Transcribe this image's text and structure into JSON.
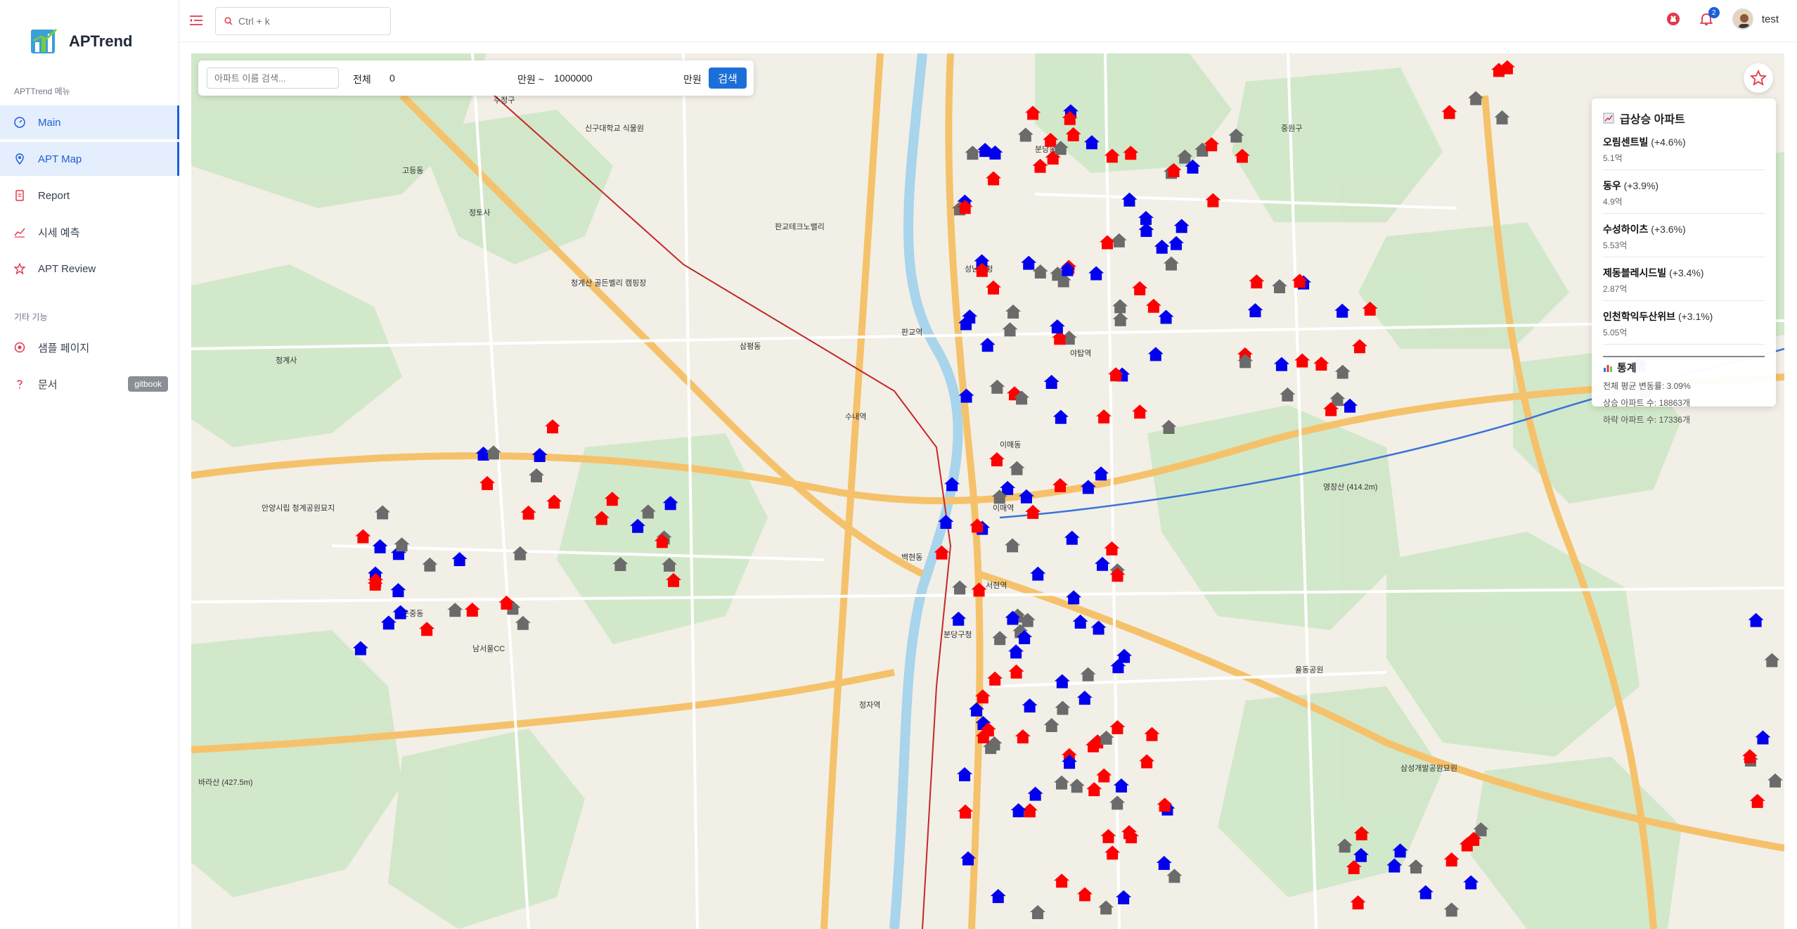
{
  "app": {
    "name": "APTrend"
  },
  "sidebar": {
    "section1_label": "APTTrend 메뉴",
    "section2_label": "기타 기능",
    "items": [
      {
        "label": "Main",
        "icon": "gauge-icon",
        "active": true
      },
      {
        "label": "APT Map",
        "icon": "map-pin-icon",
        "active": true
      },
      {
        "label": "Report",
        "icon": "document-icon",
        "active": false
      },
      {
        "label": "시세 예측",
        "icon": "line-chart-icon",
        "active": false
      },
      {
        "label": "APT Review",
        "icon": "star-icon",
        "active": false
      }
    ],
    "extra_items": [
      {
        "label": "샘플 페이지",
        "icon": "target-icon"
      },
      {
        "label": "문서",
        "icon": "question-icon",
        "badge": "gitbook"
      }
    ]
  },
  "topbar": {
    "search_placeholder": "Ctrl + k",
    "notification_count": "2",
    "username": "test"
  },
  "map_search": {
    "name_placeholder": "아파트 이름 검색...",
    "scope_label": "전체",
    "min_value": "0",
    "min_unit": "만원 ~",
    "max_value": "1000000",
    "max_unit": "만원",
    "search_button": "검색"
  },
  "trend_panel": {
    "title": "급상승 아파트",
    "items": [
      {
        "name": "오림센트빌",
        "change": "(+4.6%)",
        "price": "5.1억"
      },
      {
        "name": "동우",
        "change": "(+3.9%)",
        "price": "4.9억"
      },
      {
        "name": "수성하이츠",
        "change": "(+3.6%)",
        "price": "5.53억"
      },
      {
        "name": "제동블레시드빌",
        "change": "(+3.4%)",
        "price": "2.87억"
      },
      {
        "name": "인천학익두산위브",
        "change": "(+3.1%)",
        "price": "5.05억"
      }
    ],
    "stats_title": "통계",
    "stats": [
      "전체 평균 변동률: 3.09%",
      "상승 아파트 수: 18863개",
      "하락 아파트 수: 17336개"
    ]
  },
  "map_labels": [
    "수정구",
    "중원구",
    "성남시청",
    "분당구청",
    "이매역",
    "판교역",
    "정자역",
    "수내역",
    "서현역",
    "야탑역",
    "청계산 골든벨리 캠핑장",
    "영장산 (414.2m)",
    "바라산 (427.5m)",
    "정토사",
    "청계사",
    "고등동",
    "운중동",
    "삼평동",
    "백현동",
    "분당동",
    "이매동",
    "삼성개발공원묘원",
    "판교테크노밸리",
    "남서울CC",
    "안양시립 청계공원묘지",
    "율동공원",
    "신구대학교 식물원"
  ],
  "colors": {
    "rise": "#ff0000",
    "fall": "#0000ee",
    "flat": "#6b6b6b",
    "accent": "#1d6fd8"
  }
}
